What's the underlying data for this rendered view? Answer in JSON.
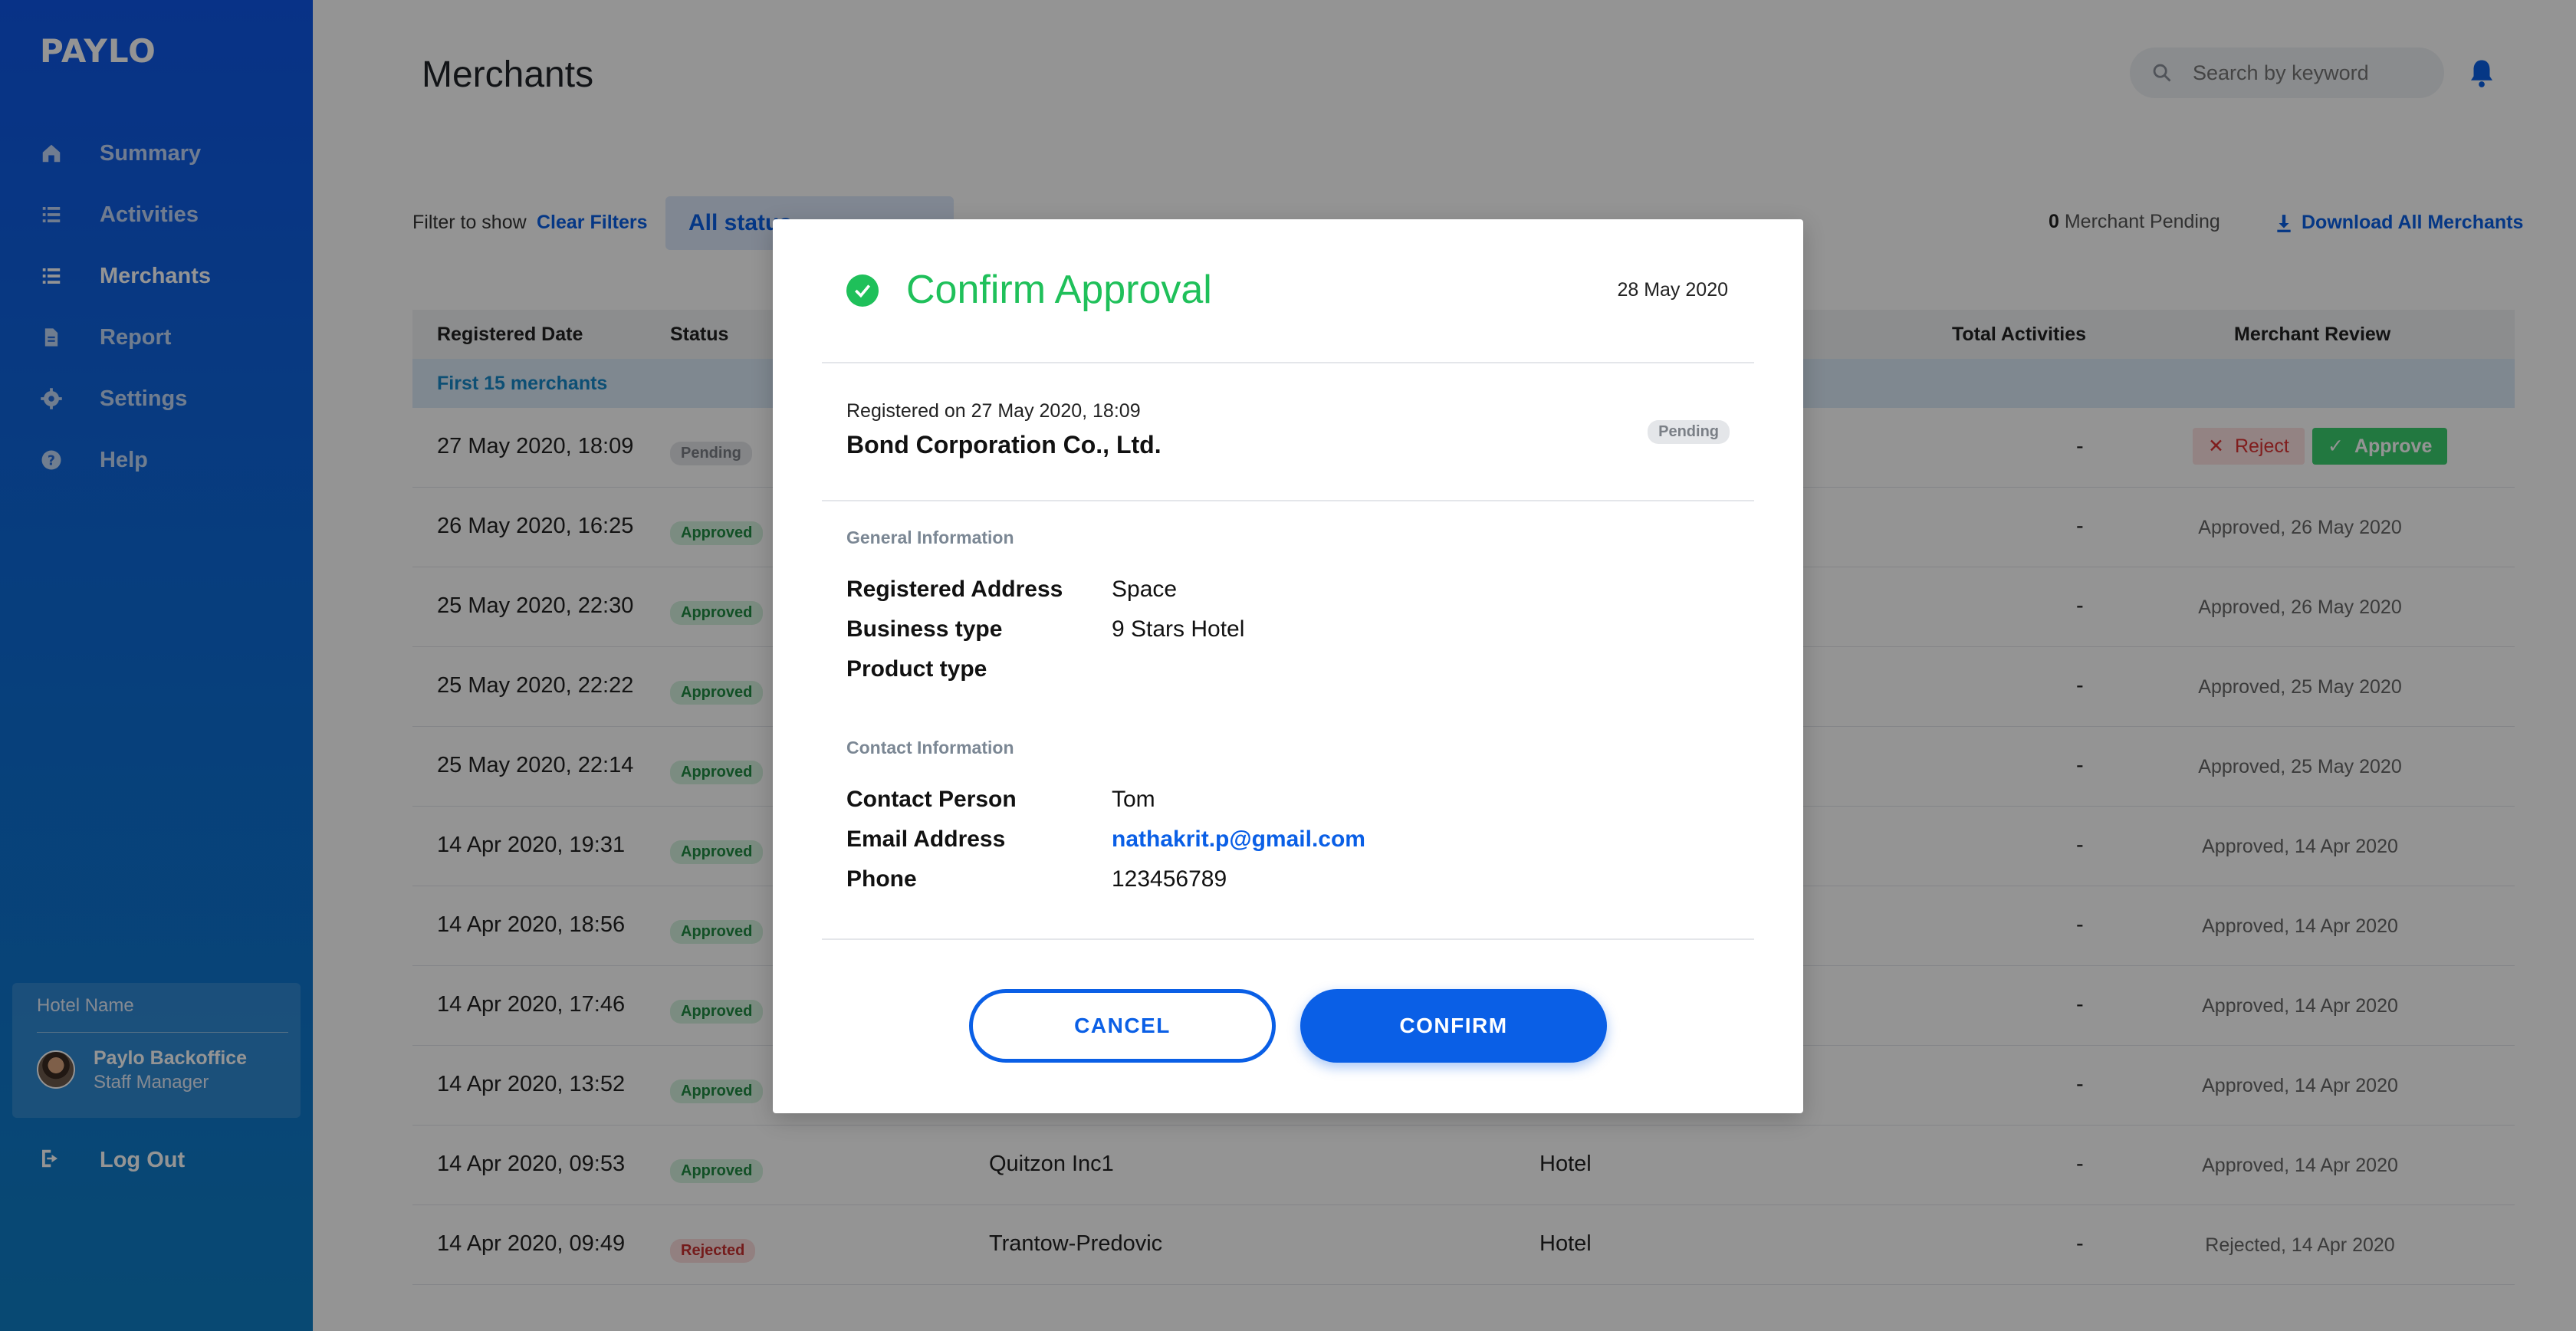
{
  "app": {
    "logo": "PAYLO"
  },
  "sidebar": {
    "items": [
      {
        "label": "Summary",
        "icon": "home-icon"
      },
      {
        "label": "Activities",
        "icon": "list-icon"
      },
      {
        "label": "Merchants",
        "icon": "list-icon",
        "active": true
      },
      {
        "label": "Report",
        "icon": "document-icon"
      },
      {
        "label": "Settings",
        "icon": "gear-icon"
      },
      {
        "label": "Help",
        "icon": "help-icon"
      }
    ],
    "hotel_name": "Hotel Name",
    "user_name": "Paylo Backoffice",
    "user_role": "Staff Manager",
    "logout": "Log Out"
  },
  "header": {
    "title": "Merchants",
    "search_placeholder": "Search by keyword"
  },
  "filters": {
    "label": "Filter to show",
    "clear": "Clear Filters",
    "status_value": "All status",
    "pending_count": "0",
    "pending_text": "Merchant Pending",
    "download": "Download All Merchants"
  },
  "table": {
    "headers": [
      "Registered Date",
      "Status",
      "Total Activities",
      "Merchant Review"
    ],
    "group_label": "First 15 merchants",
    "rows": [
      {
        "date": "27 May 2020, 18:09",
        "status": "Pending",
        "name": "",
        "type": "",
        "total": "-",
        "review": ""
      },
      {
        "date": "26 May 2020, 16:25",
        "status": "Approved",
        "name": "",
        "type": "",
        "total": "-",
        "review": "Approved, 26 May 2020"
      },
      {
        "date": "25 May 2020, 22:30",
        "status": "Approved",
        "name": "",
        "type": "",
        "total": "-",
        "review": "Approved, 26 May 2020"
      },
      {
        "date": "25 May 2020, 22:22",
        "status": "Approved",
        "name": "",
        "type": "",
        "total": "-",
        "review": "Approved, 25 May 2020"
      },
      {
        "date": "25 May 2020, 22:14",
        "status": "Approved",
        "name": "",
        "type": "",
        "total": "-",
        "review": "Approved, 25 May 2020"
      },
      {
        "date": "14 Apr 2020, 19:31",
        "status": "Approved",
        "name": "",
        "type": "",
        "total": "-",
        "review": "Approved, 14 Apr 2020"
      },
      {
        "date": "14 Apr 2020, 18:56",
        "status": "Approved",
        "name": "",
        "type": "",
        "total": "-",
        "review": "Approved, 14 Apr 2020"
      },
      {
        "date": "14 Apr 2020, 17:46",
        "status": "Approved",
        "name": "",
        "type": "",
        "total": "-",
        "review": "Approved, 14 Apr 2020"
      },
      {
        "date": "14 Apr 2020, 13:52",
        "status": "Approved",
        "name": "",
        "type": "",
        "total": "-",
        "review": "Approved, 14 Apr 2020"
      },
      {
        "date": "14 Apr 2020, 09:53",
        "status": "Approved",
        "name": "Quitzon Inc1",
        "type": "Hotel",
        "total": "-",
        "review": "Approved, 14 Apr 2020"
      },
      {
        "date": "14 Apr 2020, 09:49",
        "status": "Rejected",
        "name": "Trantow-Predovic",
        "type": "Hotel",
        "total": "-",
        "review": "Rejected, 14 Apr 2020"
      }
    ],
    "reject_label": "Reject",
    "approve_label": "Approve"
  },
  "modal": {
    "title": "Confirm Approval",
    "date": "28 May 2020",
    "registered_on": "Registered on 27 May 2020, 18:09",
    "company": "Bond Corporation Co., Ltd.",
    "status": "Pending",
    "general_heading": "General Information",
    "general": [
      {
        "key": "Registered Address",
        "value": "Space"
      },
      {
        "key": "Business type",
        "value": "9 Stars Hotel"
      },
      {
        "key": "Product type",
        "value": ""
      }
    ],
    "contact_heading": "Contact Information",
    "contact": [
      {
        "key": "Contact Person",
        "value": "Tom"
      },
      {
        "key": "Email Address",
        "value": "nathakrit.p@gmail.com"
      },
      {
        "key": "Phone",
        "value": "123456789"
      }
    ],
    "cancel_label": "CANCEL",
    "confirm_label": "CONFIRM"
  },
  "colors": {
    "brand": "#0a5fe6",
    "success": "#1fc05a",
    "sidebar_top": "#0f57e8",
    "sidebar_bottom": "#0e7fc6"
  }
}
